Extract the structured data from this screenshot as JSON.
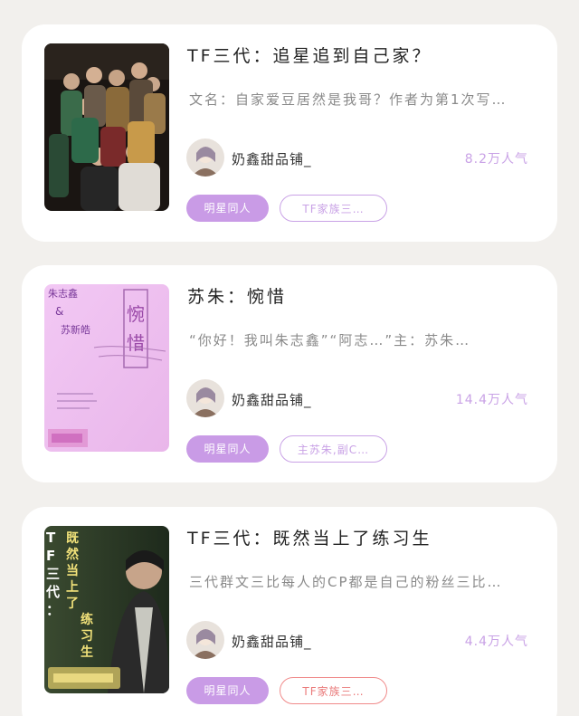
{
  "books": [
    {
      "title": "TF三代：追星追到自己家？",
      "description": "文名：自家爱豆居然是我哥？作者为第1次写…",
      "author": "奶鑫甜品铺_",
      "popularity": "8.2万人气",
      "tags": [
        "明星同人",
        "TF家族三…"
      ],
      "cover_icon": "group-photo-cover",
      "secondary_tag_color": "#c9a2e6"
    },
    {
      "title": "苏朱：惋惜",
      "description": "“你好！我叫朱志鑫”“阿志…”主：苏朱…",
      "author": "奶鑫甜品铺_",
      "popularity": "14.4万人气",
      "tags": [
        "明星同人",
        "主苏朱,副C…"
      ],
      "cover_icon": "pink-title-cover",
      "cover_text": {
        "names_top": "朱志鑫",
        "amp": "&",
        "names_bottom": "苏新皓",
        "vertical_title": "惋惜"
      },
      "secondary_tag_color": "#c9a2e6"
    },
    {
      "title": "TF三代：既然当上了练习生",
      "description": "三代群文三比每人的CP都是自己的粉丝三比…",
      "author": "奶鑫甜品铺_",
      "popularity": "4.4万人气",
      "tags": [
        "明星同人",
        "TF家族三…"
      ],
      "cover_icon": "portrait-cover",
      "cover_text": {
        "left_vertical": "TF三代：",
        "right_vertical": "既然当上了练习生"
      },
      "secondary_tag_color": "#ea7b7b"
    }
  ],
  "colors": {
    "page_bg": "#f2f0ed",
    "card_bg": "#ffffff",
    "accent_purple": "#c99be6",
    "accent_red": "#ea7b7b"
  }
}
